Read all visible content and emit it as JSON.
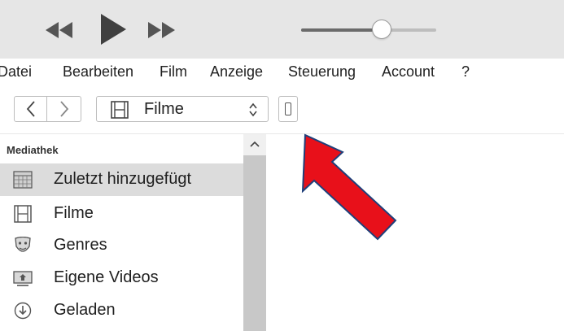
{
  "player": {
    "rewind_icon": "rewind-icon",
    "play_icon": "play-icon",
    "forward_icon": "fast-forward-icon",
    "volume_level": 0.53
  },
  "menu": {
    "items": [
      "Datei",
      "Bearbeiten",
      "Film",
      "Anzeige",
      "Steuerung",
      "Account",
      "?"
    ]
  },
  "toolbar": {
    "back_icon": "chevron-left-icon",
    "forward_icon": "chevron-right-icon",
    "media_selector": {
      "icon": "film-icon",
      "label": "Filme"
    },
    "device_icon": "iphone-icon"
  },
  "sidebar": {
    "header": "Mediathek",
    "items": [
      {
        "label": "Zuletzt hinzugefügt",
        "icon": "recently-added-icon",
        "selected": true
      },
      {
        "label": "Filme",
        "icon": "film-icon",
        "selected": false
      },
      {
        "label": "Genres",
        "icon": "genres-mask-icon",
        "selected": false
      },
      {
        "label": "Eigene Videos",
        "icon": "home-video-icon",
        "selected": false
      },
      {
        "label": "Geladen",
        "icon": "download-icon",
        "selected": false
      }
    ]
  },
  "annotation": {
    "arrow_color": "#e8101a",
    "arrow_outline": "#1f3f7a"
  }
}
